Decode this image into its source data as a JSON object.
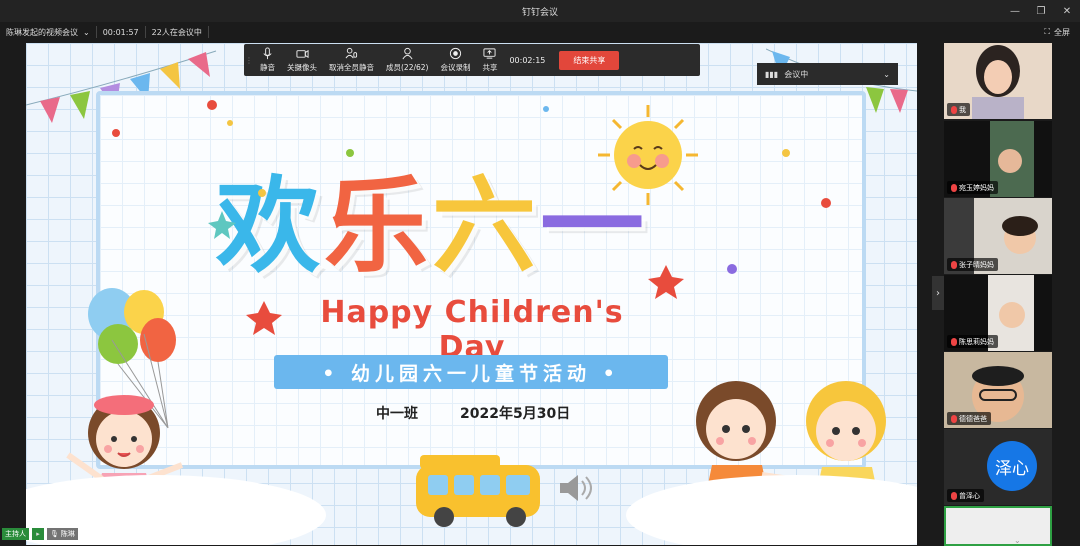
{
  "window": {
    "title": "钉钉会议"
  },
  "infobar": {
    "meeting_name": "陈琳发起的视频会议",
    "elapsed": "00:01:57",
    "participants_text": "22人在会议中",
    "fullscreen_label": "全屏"
  },
  "toolbar": {
    "buttons": [
      "静音",
      "关摄像头",
      "取消全员静音",
      "成员(22/62)",
      "会议录制",
      "共享"
    ],
    "timer": "00:02:15",
    "end_share_label": "结束共享"
  },
  "status": {
    "label": "会议中"
  },
  "slide": {
    "title_chars": [
      "欢",
      "乐",
      "六",
      "一"
    ],
    "english_title": "Happy Children's Day",
    "banner": "• 幼儿园六一儿童节活动 •",
    "class_name": "中一班",
    "date": "2022年5月30日"
  },
  "host": {
    "role_badge": "主持人",
    "name": "陈琳"
  },
  "participants": [
    {
      "name": "我"
    },
    {
      "name": "宛玉婷妈妈"
    },
    {
      "name": "张子晴妈妈"
    },
    {
      "name": "陈思莉妈妈"
    },
    {
      "name": "德德爸爸"
    },
    {
      "name": "曾泽心",
      "avatar_text": "泽心"
    }
  ],
  "colors": {
    "accent_red": "#e2473b",
    "banner_blue": "#6bb7ee",
    "avatar_blue": "#1677e6",
    "host_green": "#2a8c3b"
  }
}
